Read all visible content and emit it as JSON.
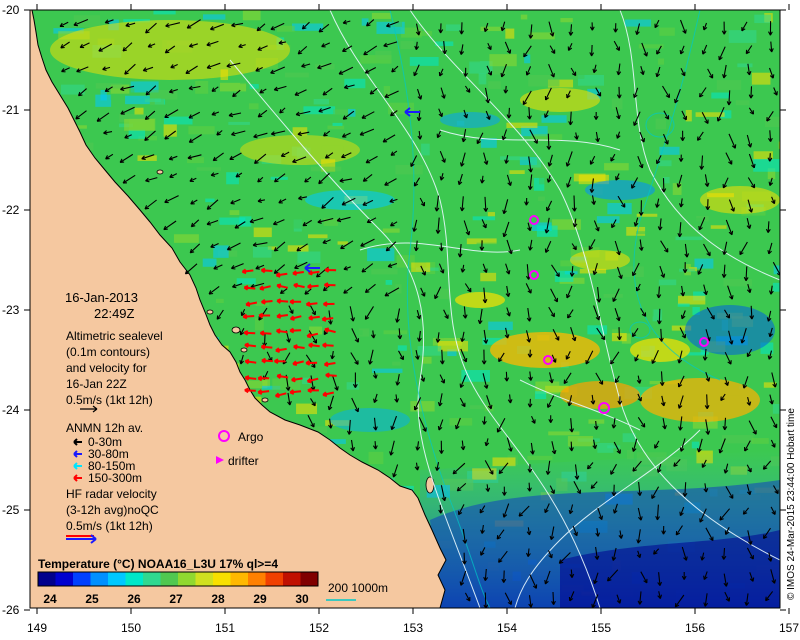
{
  "x_ticks": [
    "149",
    "150",
    "151",
    "152",
    "153",
    "154",
    "155",
    "156",
    "157"
  ],
  "y_ticks": [
    "-20",
    "-21",
    "-22",
    "-23",
    "-24",
    "-25",
    "-26"
  ],
  "date": "16-Jan-2013",
  "time": "22:49Z",
  "altimetry": {
    "lines": [
      "Altimetric sealevel",
      "(0.1m contours)",
      "and velocity for",
      "16-Jan 22Z"
    ],
    "scale": "0.5m/s (1kt 12h)"
  },
  "anmn": {
    "title": "ANMN 12h av.",
    "items": [
      {
        "label": "0-30m",
        "color": "#000000"
      },
      {
        "label": "30-80m",
        "color": "#1a1aff"
      },
      {
        "label": "80-150m",
        "color": "#00e5ff"
      },
      {
        "label": "150-300m",
        "color": "#ff0000"
      }
    ]
  },
  "markers": {
    "argo": "Argo",
    "drifter": "drifter",
    "argo_color": "#ff00ff"
  },
  "hf_radar": {
    "lines": [
      "HF radar velocity",
      "(3-12h avg)noQC"
    ],
    "scale": "0.5m/s (1kt 12h)"
  },
  "colorbar": {
    "title": "Temperature (°C) NOAA16_L3U 17% ql>=4",
    "ticks": [
      "24",
      "25",
      "26",
      "27",
      "28",
      "29",
      "30"
    ],
    "colors": [
      "#00008c",
      "#0000d0",
      "#0040ff",
      "#0090ff",
      "#00c8ff",
      "#00e8c8",
      "#30d890",
      "#50c850",
      "#90d830",
      "#d0e020",
      "#f8e000",
      "#ffb800",
      "#ff8000",
      "#f04000",
      "#c01000",
      "#800000"
    ]
  },
  "depth_legend": {
    "label": "200  1000m",
    "color": "#00c8c8"
  },
  "credit": "© IMOS 24-Mar-2015 23:44:00 Hobart time",
  "colors": {
    "land": "#f5c8a0",
    "ocean_base": "#3cc850"
  }
}
